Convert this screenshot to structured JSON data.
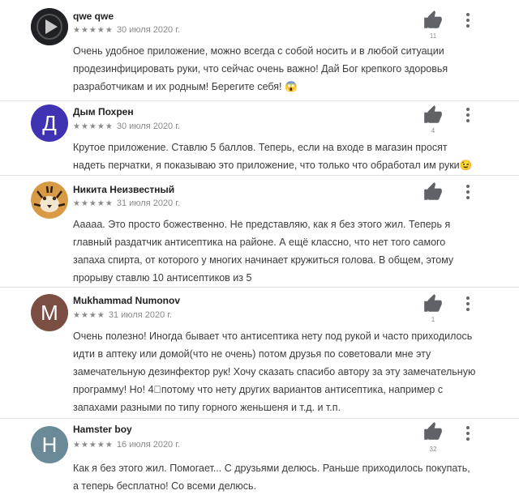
{
  "reviews": [
    {
      "author": "qwe qwe",
      "stars": "★★★★★",
      "date": "30 июля 2020 г.",
      "likes": "11",
      "text": "Очень удобное приложение, можно всегда с собой носить и в любой ситуации продезинфицировать руки, что сейчас очень важно! Дай Бог крепкого здоровья разработчикам и их родным! Берегите себя! 😱",
      "avatar_icon": "play-logo-icon",
      "avatar_color": "#1f2124"
    },
    {
      "author": "Дым Похрен",
      "stars": "★★★★★",
      "date": "30 июля 2020 г.",
      "likes": "4",
      "text": "Крутое приложение. Ставлю 5 баллов. Теперь, если на входе в магазин просят надеть перчатки, я показываю это приложение, что только что обработал им руки😉",
      "avatar_letter": "Д",
      "avatar_color": "#3f33b3"
    },
    {
      "author": "Никита Неизвестный",
      "stars": "★★★★★",
      "date": "31 июля 2020 г.",
      "likes": "",
      "text": "Ааааа. Это просто божественно. Не представляю, как я без этого жил. Теперь я главный раздатчик антисептика на районе. А ещё классно, что нет того самого запаха спирта, от которого у многих начинает кружиться голова. В общем, этому прорыву ставлю 10 антисептиков из 5",
      "avatar_icon": "tiger-avatar-icon",
      "avatar_color": "#c98a3a"
    },
    {
      "author": "Mukhammad Numonov",
      "stars": "★★★★",
      "date": "31 июля 2020 г.",
      "likes": "1",
      "text": "Очень полезно! Иногда бывает что антисептика нету под рукой и часто приходилось идти в аптеку или домой(что не очень) потом друзья по советовали мне эту замечательную дезинфектор рук! Хочу сказать спасибо автору за эту замечательную программу! Но! 4⃣потому что нету других вариантов антисептика, например с запахами разными по типу горного женьшеня и т.д. и т.п.",
      "avatar_letter": "M",
      "avatar_color": "#7a4e43"
    },
    {
      "author": "Hamster boy",
      "stars": "★★★★★",
      "date": "16 июля 2020 г.",
      "likes": "32",
      "text": "Как я без этого жил. Помогает... С друзьями делюсь. Раньше приходилось покупать, а теперь бесплатно! Со всеми делюсь.",
      "avatar_letter": "H",
      "avatar_color": "#6a8a98"
    }
  ]
}
